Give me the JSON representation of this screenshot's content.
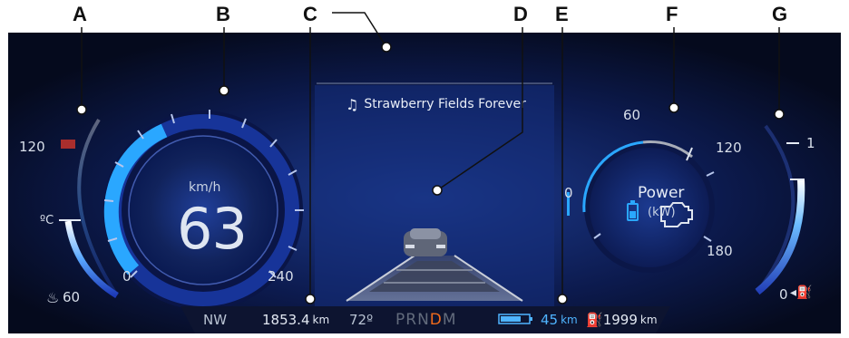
{
  "labels": [
    "A",
    "B",
    "C",
    "D",
    "E",
    "F",
    "G"
  ],
  "media": {
    "song_title": "Strawberry Fields Forever",
    "icon": "music-note-icon"
  },
  "temperature": {
    "max": "120",
    "unit": "ºC",
    "min": "60",
    "icon": "coolant-temperature-icon"
  },
  "speedometer": {
    "unit": "km/h",
    "speed": "63",
    "min": "0",
    "max": "240"
  },
  "power": {
    "title": "Power",
    "unit": "(kW)",
    "ticks": [
      "0",
      "60",
      "120",
      "180"
    ],
    "icons": [
      "battery-icon",
      "engine-icon"
    ]
  },
  "fuel": {
    "full": "1",
    "empty": "0",
    "icon": "fuel-pump-icon"
  },
  "status_bar": {
    "compass": "NW",
    "odometer": "1853.4",
    "odometer_unit": "km",
    "outside_temp": "72º",
    "gears": [
      "P",
      "R",
      "N",
      "D",
      "M"
    ],
    "active_gear": "D",
    "ev_range": "45",
    "ev_range_unit": "km",
    "fuel_range": "1999",
    "fuel_range_unit": "km"
  },
  "colors": {
    "background": "#071027",
    "accent_blue": "#2aa7ff",
    "gear_active": "#f06a1b",
    "warning_red": "#d2362a"
  }
}
